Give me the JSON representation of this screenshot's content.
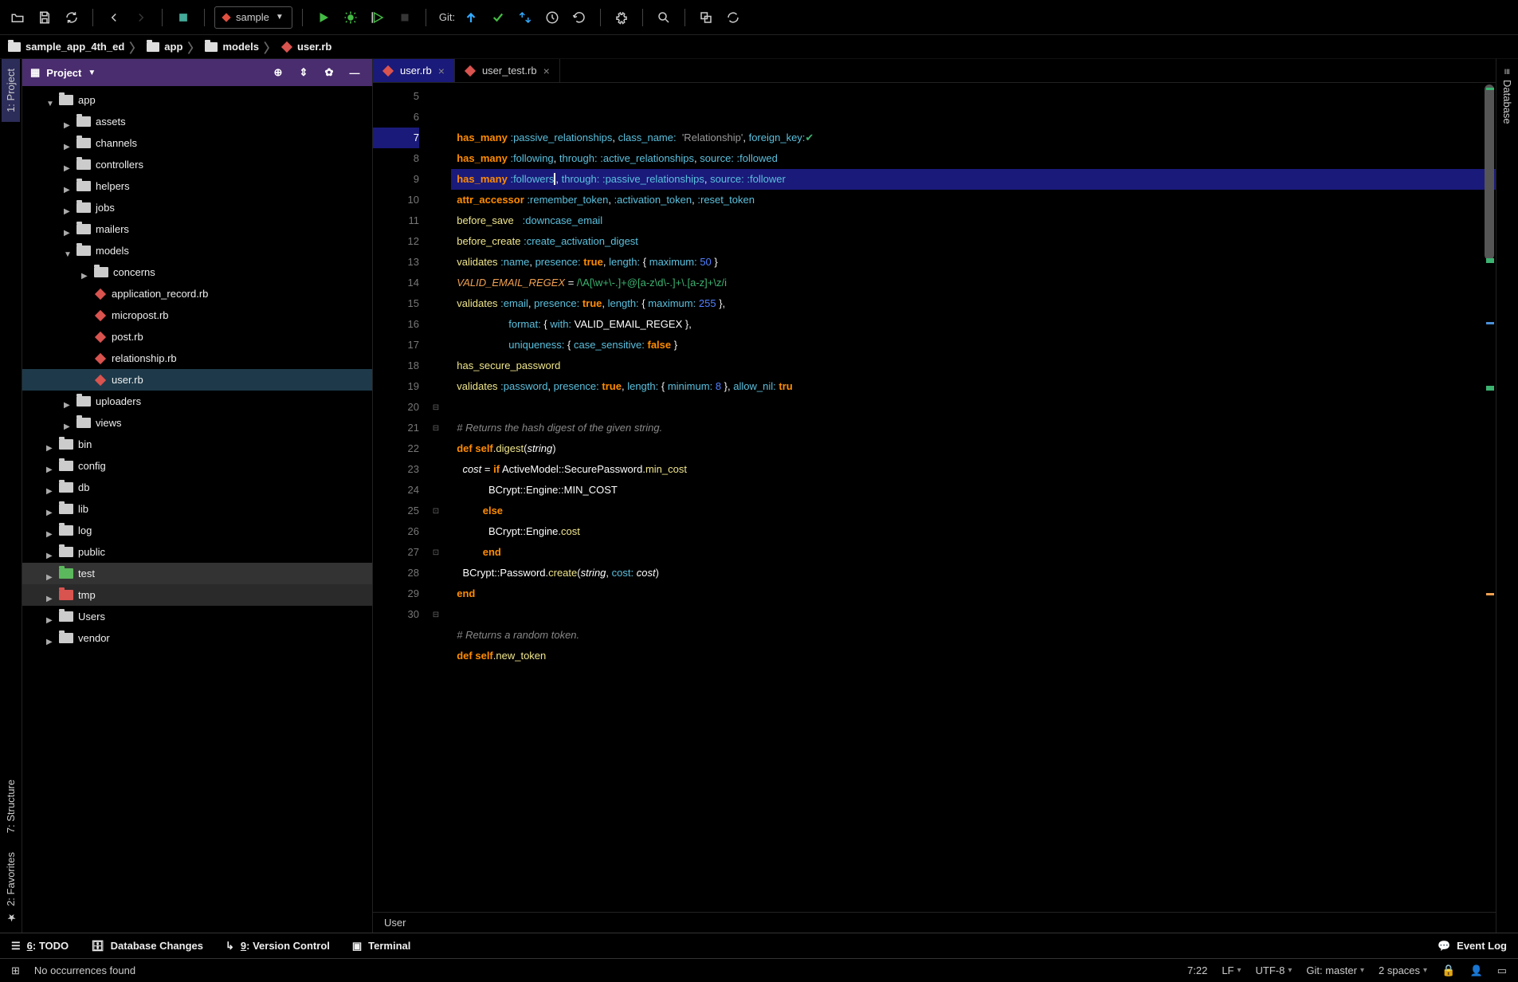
{
  "toolbar": {
    "run_config_label": "sample",
    "git_label": "Git:"
  },
  "breadcrumb": {
    "items": [
      {
        "label": "sample_app_4th_ed",
        "icon": "folder"
      },
      {
        "label": "app",
        "icon": "folder"
      },
      {
        "label": "models",
        "icon": "folder"
      },
      {
        "label": "user.rb",
        "icon": "ruby"
      }
    ]
  },
  "left_tool_tabs": {
    "project": "1: Project",
    "structure": "7: Structure",
    "favorites": "2: Favorites"
  },
  "right_tool_tabs": {
    "database": "Database"
  },
  "project_panel": {
    "title": "Project",
    "tree": [
      {
        "indent": 1,
        "arrow": "d",
        "icon": "folder",
        "label": "app"
      },
      {
        "indent": 2,
        "arrow": "r",
        "icon": "folder",
        "label": "assets"
      },
      {
        "indent": 2,
        "arrow": "r",
        "icon": "folder",
        "label": "channels"
      },
      {
        "indent": 2,
        "arrow": "r",
        "icon": "folder",
        "label": "controllers"
      },
      {
        "indent": 2,
        "arrow": "r",
        "icon": "folder",
        "label": "helpers"
      },
      {
        "indent": 2,
        "arrow": "r",
        "icon": "folder",
        "label": "jobs"
      },
      {
        "indent": 2,
        "arrow": "r",
        "icon": "folder",
        "label": "mailers"
      },
      {
        "indent": 2,
        "arrow": "d",
        "icon": "folder",
        "label": "models"
      },
      {
        "indent": 3,
        "arrow": "r",
        "icon": "folder",
        "label": "concerns"
      },
      {
        "indent": 3,
        "arrow": "none",
        "icon": "ruby",
        "label": "application_record.rb"
      },
      {
        "indent": 3,
        "arrow": "none",
        "icon": "ruby",
        "label": "micropost.rb"
      },
      {
        "indent": 3,
        "arrow": "none",
        "icon": "ruby",
        "label": "post.rb"
      },
      {
        "indent": 3,
        "arrow": "none",
        "icon": "ruby",
        "label": "relationship.rb"
      },
      {
        "indent": 3,
        "arrow": "none",
        "icon": "ruby",
        "label": "user.rb",
        "selected": true
      },
      {
        "indent": 2,
        "arrow": "r",
        "icon": "folder",
        "label": "uploaders"
      },
      {
        "indent": 2,
        "arrow": "r",
        "icon": "folder",
        "label": "views"
      },
      {
        "indent": 1,
        "arrow": "r",
        "icon": "folder",
        "label": "bin"
      },
      {
        "indent": 1,
        "arrow": "r",
        "icon": "folder",
        "label": "config"
      },
      {
        "indent": 1,
        "arrow": "r",
        "icon": "folder",
        "label": "db"
      },
      {
        "indent": 1,
        "arrow": "r",
        "icon": "folder",
        "label": "lib"
      },
      {
        "indent": 1,
        "arrow": "r",
        "icon": "folder",
        "label": "log"
      },
      {
        "indent": 1,
        "arrow": "r",
        "icon": "folder",
        "label": "public"
      },
      {
        "indent": 1,
        "arrow": "r",
        "icon": "folder-green",
        "label": "test",
        "hl": 1
      },
      {
        "indent": 1,
        "arrow": "r",
        "icon": "folder-red",
        "label": "tmp",
        "hl": 2
      },
      {
        "indent": 1,
        "arrow": "r",
        "icon": "folder",
        "label": "Users"
      },
      {
        "indent": 1,
        "arrow": "r",
        "icon": "folder",
        "label": "vendor"
      }
    ]
  },
  "editor": {
    "tabs": [
      {
        "label": "user.rb",
        "icon": "ruby",
        "active": true
      },
      {
        "label": "user_test.rb",
        "icon": "ruby-test",
        "active": false
      }
    ],
    "first_line": 5,
    "current_line": 7,
    "lines": [
      {
        "n": 5,
        "html": "  <span class='kw'>has_many</span> <span class='sym'>:passive_relationships</span><span class='pn'>,</span> <span class='sym'>class_name:</span>  <span class='str'>'Relationship'</span><span class='pn'>,</span> <span class='sym'>foreign_key:</span><span style='color:#3cb371'>✔</span>"
      },
      {
        "n": 6,
        "html": "  <span class='kw'>has_many</span> <span class='sym'>:following</span><span class='pn'>,</span> <span class='sym'>through:</span> <span class='sym'>:active_relationships</span><span class='pn'>,</span> <span class='sym'>source:</span> <span class='sym'>:followed</span>"
      },
      {
        "n": 7,
        "html": "  <span class='kw'>has_many</span> <span class='sym'>:followers</span><span class='caret'></span><span class='pn'>,</span> <span class='sym'>through:</span> <span class='sym'>:passive_relationships</span><span class='pn'>,</span> <span class='sym'>source:</span> <span class='sym'>:follower</span>"
      },
      {
        "n": 8,
        "html": "  <span class='kw'>attr_accessor</span> <span class='sym'>:remember_token</span><span class='pn'>,</span> <span class='sym'>:activation_token</span><span class='pn'>,</span> <span class='sym'>:reset_token</span>"
      },
      {
        "n": 9,
        "html": "  <span class='fn'>before_save</span>   <span class='sym'>:downcase_email</span>"
      },
      {
        "n": 10,
        "html": "  <span class='fn'>before_create</span> <span class='sym'>:create_activation_digest</span>"
      },
      {
        "n": 11,
        "html": "  <span class='fn'>validates</span> <span class='sym'>:name</span><span class='pn'>,</span> <span class='sym'>presence:</span> <span class='kw'>true</span><span class='pn'>,</span> <span class='sym'>length:</span> <span class='pn'>{</span> <span class='sym'>maximum:</span> <span class='num'>50</span> <span class='pn'>}</span>"
      },
      {
        "n": 12,
        "html": "  <span class='ct'>VALID_EMAIL_REGEX</span> <span class='pn'>=</span> <span class='rx'>/\\A[\\w+\\-.]+@[a-z\\d\\-.]+\\.[a-z]+\\z/i</span>"
      },
      {
        "n": 13,
        "html": "  <span class='fn'>validates</span> <span class='sym'>:email</span><span class='pn'>,</span> <span class='sym'>presence:</span> <span class='kw'>true</span><span class='pn'>,</span> <span class='sym'>length:</span> <span class='pn'>{</span> <span class='sym'>maximum:</span> <span class='num'>255</span> <span class='pn'>},</span>"
      },
      {
        "n": 14,
        "html": "                    <span class='sym'>format:</span> <span class='pn'>{</span> <span class='sym'>with:</span> <span class='id'>VALID_EMAIL_REGEX</span> <span class='pn'>},</span>"
      },
      {
        "n": 15,
        "html": "                    <span class='sym'>uniqueness:</span> <span class='pn'>{</span> <span class='sym'>case_sensitive:</span> <span class='kw'>false</span> <span class='pn'>}</span>"
      },
      {
        "n": 16,
        "html": "  <span class='fn'>has_secure_password</span>"
      },
      {
        "n": 17,
        "html": "  <span class='fn'>validates</span> <span class='sym'>:password</span><span class='pn'>,</span> <span class='sym'>presence:</span> <span class='kw'>true</span><span class='pn'>,</span> <span class='sym'>length:</span> <span class='pn'>{</span> <span class='sym'>minimum:</span> <span class='num'>8</span> <span class='pn'>},</span> <span class='sym'>allow_nil:</span> <span class='kw'>tru</span>"
      },
      {
        "n": 18,
        "html": ""
      },
      {
        "n": 19,
        "html": "  <span class='cm'># Returns the hash digest of the given string.</span>"
      },
      {
        "n": 20,
        "html": "  <span class='kw'>def</span> <span class='kw'>self</span><span class='pn'>.</span><span class='fn'>digest</span><span class='pn'>(</span><span class='it id'>string</span><span class='pn'>)</span>",
        "fold": "⊟"
      },
      {
        "n": 21,
        "html": "    <span class='it id'>cost</span> <span class='pn'>=</span> <span class='kw'>if</span> <span class='id'>ActiveModel</span><span class='pn'>::</span><span class='id'>SecurePassword</span><span class='pn'>.</span><span class='fn'>min_cost</span>",
        "fold": "⊟"
      },
      {
        "n": 22,
        "html": "             <span class='id'>BCrypt</span><span class='pn'>::</span><span class='id'>Engine</span><span class='pn'>::</span><span class='id'>MIN_COST</span>"
      },
      {
        "n": 23,
        "html": "           <span class='kw'>else</span>"
      },
      {
        "n": 24,
        "html": "             <span class='id'>BCrypt</span><span class='pn'>::</span><span class='id'>Engine</span><span class='pn'>.</span><span class='fn'>cost</span>"
      },
      {
        "n": 25,
        "html": "           <span class='kw'>end</span>",
        "fold": "⊡"
      },
      {
        "n": 26,
        "html": "    <span class='id'>BCrypt</span><span class='pn'>::</span><span class='id'>Password</span><span class='pn'>.</span><span class='fn'>create</span><span class='pn'>(</span><span class='it id'>string</span><span class='pn'>,</span> <span class='sym'>cost:</span> <span class='it id'>cost</span><span class='pn'>)</span>"
      },
      {
        "n": 27,
        "html": "  <span class='kw'>end</span>",
        "fold": "⊡"
      },
      {
        "n": 28,
        "html": ""
      },
      {
        "n": 29,
        "html": "  <span class='cm'># Returns a random token.</span>"
      },
      {
        "n": 30,
        "html": "  <span class='kw'>def</span> <span class='kw'>self</span><span class='pn'>.</span><span class='fn'>new_token</span>",
        "fold": "⊟"
      }
    ],
    "context_label": "User"
  },
  "bottom_bar": {
    "todo": "6: TODO",
    "db_changes": "Database Changes",
    "vcs": "9: Version Control",
    "terminal": "Terminal",
    "event_log": "Event Log"
  },
  "status_bar": {
    "message": "No occurrences found",
    "position": "7:22",
    "line_sep": "LF",
    "encoding": "UTF-8",
    "git_branch": "Git: master",
    "indent": "2 spaces"
  }
}
